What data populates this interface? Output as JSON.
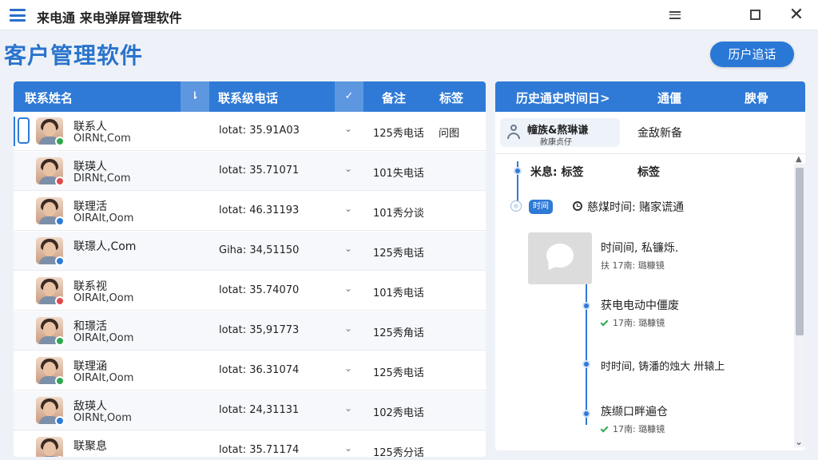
{
  "window": {
    "app_title": "来电通  来电弹屏管理软件",
    "min_icon": "minimize-icon",
    "max_icon": "maximize-icon",
    "close_label": "✕"
  },
  "page_title": "客户管理软件",
  "history_button": "历户追话",
  "contacts_table": {
    "headers": {
      "name": "联系姓名",
      "phone": "联系级电话",
      "note": "备注",
      "tag": "标签"
    },
    "sort_symbols": {
      "name": "⇂",
      "phone": "✓"
    },
    "rows": [
      {
        "name": "联系人",
        "email": "OIRNt,Com",
        "phone": "lotat: 35.91A03",
        "note": "125秀电话",
        "tag": "问图",
        "status": "green"
      },
      {
        "name": "联瑛人",
        "email": "DIRNt,Com",
        "phone": "lotat: 35.71071",
        "note": "101失电话",
        "tag": "",
        "status": "red"
      },
      {
        "name": "联理活",
        "email": "OIRAIt,Oom",
        "phone": "lotat: 46.31193",
        "note": "101秀分谈",
        "tag": "",
        "status": "blue"
      },
      {
        "name": "联璟人,Com",
        "email": "",
        "phone": "Giha: 34,51150",
        "note": "125秀电话",
        "tag": "",
        "status": "blue"
      },
      {
        "name": "联系视",
        "email": "OIRAIt,Oom",
        "phone": "lotat: 35.74070",
        "note": "101秀电话",
        "tag": "",
        "status": "red"
      },
      {
        "name": "和璟活",
        "email": "OIRAIt,Oom",
        "phone": "lotat: 35,91773",
        "note": "125秀角话",
        "tag": "",
        "status": "green"
      },
      {
        "name": "联理涵",
        "email": "OIRAIt,Oom",
        "phone": "lotat: 36.31074",
        "note": "125秀电话",
        "tag": "",
        "status": "green"
      },
      {
        "name": "敌瑛人",
        "email": "OIRNt,Oom",
        "phone": "lotat: 24,31131",
        "note": "102秀电话",
        "tag": "",
        "status": "blue"
      },
      {
        "name": "联聚息",
        "email": "",
        "phone": "lotat: 35.71174",
        "note": "125秀分话",
        "tag": "",
        "status": "green"
      }
    ]
  },
  "history_panel": {
    "headers": {
      "time": "历史通史时间日>",
      "comm": "通僵",
      "extra": "腴骨"
    },
    "caller": {
      "name": "幢族&熬琳谦",
      "sub": "赦康贞仔",
      "status": "金敌新备"
    },
    "event_top": {
      "left": "米息: 标签",
      "right": "标签"
    },
    "pill": "时间",
    "time_line": "慈煤时间: 赌家谎通",
    "events": [
      {
        "title": "时间间, 私镰烁.",
        "meta": "扶 17南: 璐糠镜",
        "check": false
      },
      {
        "title": "获电电动中僵废",
        "meta": "17南: 璐糠镜",
        "check": true
      },
      {
        "title": "时时间, 铸潘的烛大  卅辕上",
        "meta": "",
        "check": false
      },
      {
        "title": "族缬口畔遍仓",
        "meta": "17南: 璐糠镜",
        "check": true
      }
    ]
  }
}
